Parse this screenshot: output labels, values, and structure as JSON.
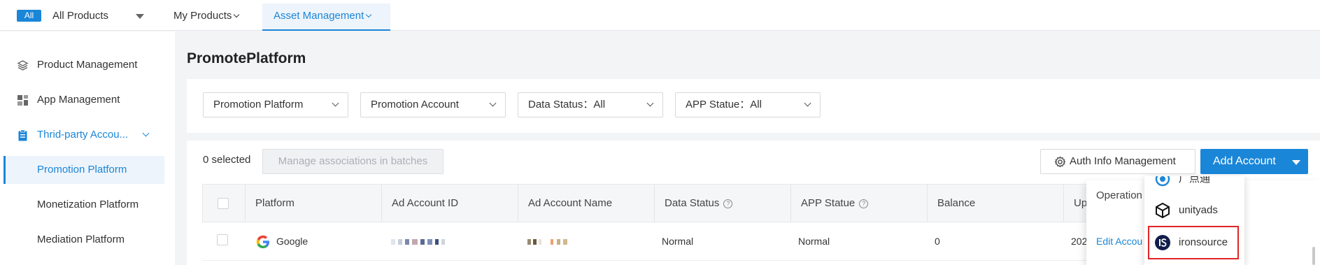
{
  "topnav": {
    "all_badge": "All",
    "all_products": "All Products",
    "my_products": "My Products",
    "asset_management": "Asset Management"
  },
  "sidebar": {
    "items": [
      {
        "label": "Product Management",
        "icon": "layers-icon"
      },
      {
        "label": "App Management",
        "icon": "grid-icon"
      },
      {
        "label": "Thrid-party Accou...",
        "icon": "clipboard-icon"
      }
    ],
    "sub_items": [
      {
        "label": "Promotion Platform",
        "active": true
      },
      {
        "label": "Monetization Platform",
        "active": false
      },
      {
        "label": "Mediation Platform",
        "active": false
      }
    ]
  },
  "page": {
    "title": "PromotePlatform"
  },
  "filters": {
    "promotion_platform": "Promotion Platform",
    "promotion_account": "Promotion Account",
    "data_status": "Data Status：All",
    "app_statue": "APP Statue：All"
  },
  "toolbar": {
    "selected_count": "0 selected",
    "batch_label": "Manage associations in batches",
    "auth_label": "Auth Info Management",
    "add_label": "Add Account"
  },
  "table": {
    "headers": {
      "platform": "Platform",
      "ad_account_id": "Ad Account ID",
      "ad_account_name": "Ad Account Name",
      "data_status": "Data Status",
      "app_statue": "APP Statue",
      "balance": "Balance",
      "updated": "Up",
      "operation": "Operation"
    },
    "rows": [
      {
        "platform": "Google",
        "data_status": "Normal",
        "app_statue": "Normal",
        "balance": "0",
        "updated": "202",
        "operation": "Edit Accou"
      }
    ]
  },
  "dropdown": {
    "items": [
      {
        "label": "广点通",
        "icon": "guangdiantong-icon"
      },
      {
        "label": "unityads",
        "icon": "unity-icon"
      },
      {
        "label": "ironsource",
        "icon": "ironsource-icon"
      }
    ]
  },
  "colors": {
    "accent": "#1a86d8",
    "highlight": "#e02424"
  }
}
